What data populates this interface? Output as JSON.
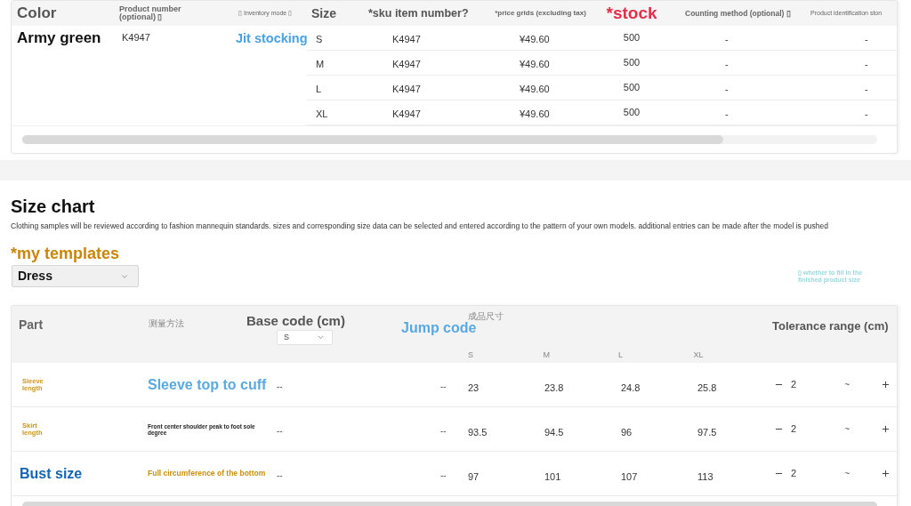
{
  "sku_table": {
    "columns": [
      "Color",
      "Product number (optional) ▯",
      "▯ Inventory mode ▯",
      "Size",
      "*sku item number?",
      "*price grids (excluding tax)",
      "*stock",
      "Counting method (optional) ▯",
      "Product identification ston"
    ],
    "color_group": {
      "variant": "Army green",
      "product_number": "K4947",
      "inventory_mode": "Jit stocking"
    },
    "rows": [
      {
        "size": "S",
        "sku_item_number": "K4947",
        "price": "¥49.60",
        "stock": "500",
        "counting_method": "-",
        "product_identification": "-"
      },
      {
        "size": "M",
        "sku_item_number": "K4947",
        "price": "¥49.60",
        "stock": "500",
        "counting_method": "-",
        "product_identification": "-"
      },
      {
        "size": "L",
        "sku_item_number": "K4947",
        "price": "¥49.60",
        "stock": "500",
        "counting_method": "-",
        "product_identification": "-"
      },
      {
        "size": "XL",
        "sku_item_number": "K4947",
        "price": "¥49.60",
        "stock": "500",
        "counting_method": "-",
        "product_identification": "-"
      }
    ]
  },
  "size_chart": {
    "title": "Size chart",
    "description": "Clothing samples will be reviewed according to fashion mannequin standards. sizes and corresponding size data can be selected and entered according to the pattern of your own models. additional entries can be made after the model is pushed",
    "templates_label": "*my templates",
    "template_select": {
      "value": "Dress"
    },
    "finished_size_hint": "▯ whether to fill in the finished product size",
    "table": {
      "headers": {
        "part": "Part",
        "measurement_method": "测量方法",
        "base_code": "Base code (cm)",
        "base_code_select": {
          "value": "S"
        },
        "jump_code": "Jump code",
        "finished_size": "成品尺寸",
        "sizes": [
          "S",
          "M",
          "L",
          "XL"
        ],
        "tolerance": "Tolerance range (cm)"
      },
      "rows": [
        {
          "part": {
            "text": "Sleeve length",
            "kind": "note"
          },
          "method": {
            "text": "Sleeve top to cuff",
            "kind": "callout"
          },
          "base_code": "--",
          "jump_code": "--",
          "values": [
            "23",
            "23.8",
            "24.8",
            "25.8"
          ],
          "tolerance_minus": "2",
          "tolerance_separator": "~"
        },
        {
          "part": {
            "text": "Skirt length",
            "kind": "note"
          },
          "method": {
            "text": "Front center shoulder peak to foot sole degree",
            "kind": "plain"
          },
          "base_code": "--",
          "jump_code": "--",
          "values": [
            "93.5",
            "94.5",
            "96",
            "97.5"
          ],
          "tolerance_minus": "2",
          "tolerance_separator": "~"
        },
        {
          "part": {
            "text": "Bust size",
            "kind": "heading"
          },
          "method": {
            "text": "Full circumference of the bottom",
            "kind": "note"
          },
          "base_code": "--",
          "jump_code": "--",
          "values": [
            "97",
            "101",
            "107",
            "113"
          ],
          "tolerance_minus": "2",
          "tolerance_separator": "~"
        }
      ]
    }
  }
}
